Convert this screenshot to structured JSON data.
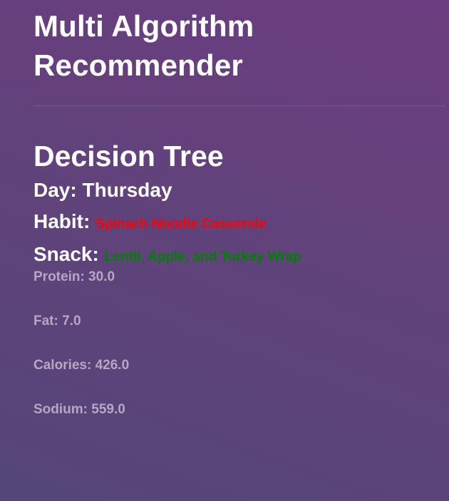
{
  "header": {
    "title": "Multi Algorithm Recommender"
  },
  "section": {
    "title": "Decision Tree",
    "day_label": "Day:",
    "day_value": "Thursday",
    "habit_label": "Habit:",
    "habit_value": "Spinach Noodle Casserole",
    "snack_label": "Snack:",
    "snack_value": "Lentil, Apple, and Turkey Wrap"
  },
  "nutrients": {
    "protein": "Protein: 30.0",
    "fat": "Fat: 7.0",
    "calories": "Calories: 426.0",
    "sodium": "Sodium: 559.0"
  },
  "colors": {
    "habit_value": "#ff0000",
    "snack_value": "#008000",
    "nutrient_text": "#b8a6c6",
    "background_top": "#6c3d80",
    "background_bottom": "#544679"
  }
}
